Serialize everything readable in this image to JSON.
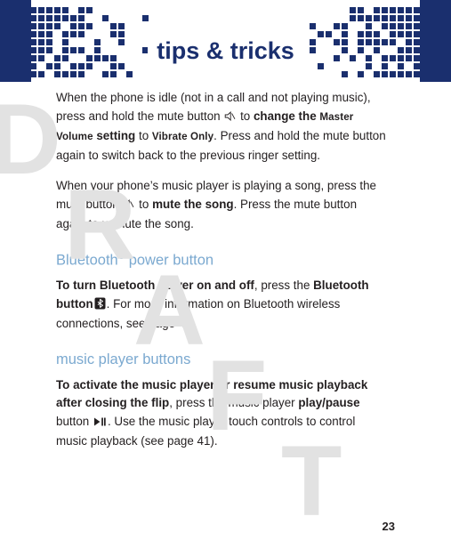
{
  "header": {
    "title": "tips & tricks",
    "accent_color": "#1a2f6e"
  },
  "watermark": {
    "text": "DRAFT",
    "color": "#e2e2e2"
  },
  "content": {
    "para1": {
      "t1": "When the phone is idle (not in a call and not playing music), press and hold the mute button ",
      "icon1": "mute-icon",
      "t2": " to ",
      "b1": "change the ",
      "sc1": "Master Volume",
      "b2": " setting",
      "t3": " to ",
      "sc2": "Vibrate Only",
      "t4": ". Press and hold the mute button again to switch back to the previous ringer setting."
    },
    "para2": {
      "t1": "When your phone’s music player is playing a song, press the mute button ",
      "icon1": "mute-icon",
      "t2": " to ",
      "b1": "mute the song",
      "t3": ". Press the mute button again to unmute the song."
    },
    "section1": {
      "title": "Bluetooth",
      "title_sup": "®",
      "title_rest": " power button"
    },
    "para3": {
      "b1": "To turn Bluetooth power on and off",
      "t1": ", press the ",
      "b2": "Bluetooth button",
      "icon1": "bluetooth-icon",
      "t2": ". For more information on Bluetooth wireless connections, see page 45."
    },
    "section2": {
      "title": "music player buttons"
    },
    "para4": {
      "b1": "To activate the music player or resume music playback after closing the flip",
      "t1": ", press the music player ",
      "b2": "play/pause",
      "t2": " button ",
      "icon1": "play-pause-icon",
      "t3": ". Use the music player touch controls to control music playback (see page 41)."
    }
  },
  "footer": {
    "page_number": "23"
  }
}
